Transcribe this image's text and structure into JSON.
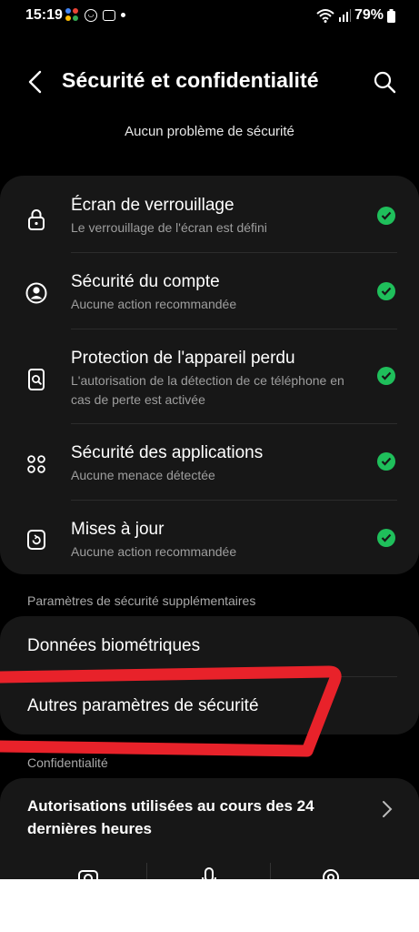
{
  "status_bar": {
    "time": "15:19",
    "battery": "79%",
    "icons": [
      "assistant-icon",
      "face-icon",
      "app-icon",
      "dot-icon",
      "wifi-icon",
      "signal-icon",
      "battery-icon"
    ]
  },
  "header": {
    "title": "Sécurité et confidentialité",
    "subtitle": "Aucun problème de sécurité"
  },
  "security_items": [
    {
      "label": "Écran de verrouillage",
      "sub": "Le verrouillage de l'écran est défini",
      "icon": "lock-icon"
    },
    {
      "label": "Sécurité du compte",
      "sub": "Aucune action recommandée",
      "icon": "account-icon"
    },
    {
      "label": "Protection de l'appareil perdu",
      "sub": "L'autorisation de la détection de ce téléphone en cas de perte est activée",
      "icon": "find-device-icon"
    },
    {
      "label": "Sécurité des applications",
      "sub": "Aucune menace détectée",
      "icon": "apps-icon"
    },
    {
      "label": "Mises à jour",
      "sub": "Aucune action recommandée",
      "icon": "update-icon"
    }
  ],
  "extra_section": {
    "label": "Paramètres de sécurité supplémentaires",
    "items": [
      "Données biométriques",
      "Autres paramètres de sécurité"
    ]
  },
  "privacy_section": {
    "label": "Confidentialité",
    "permissions": "Autorisations utilisées au cours des 24 dernières heures",
    "permission_icons": [
      "camera-icon",
      "microphone-icon",
      "location-icon"
    ]
  },
  "colors": {
    "background": "#000000",
    "card": "#171717",
    "check": "#1fbf5b",
    "annotation": "#e8222a"
  }
}
